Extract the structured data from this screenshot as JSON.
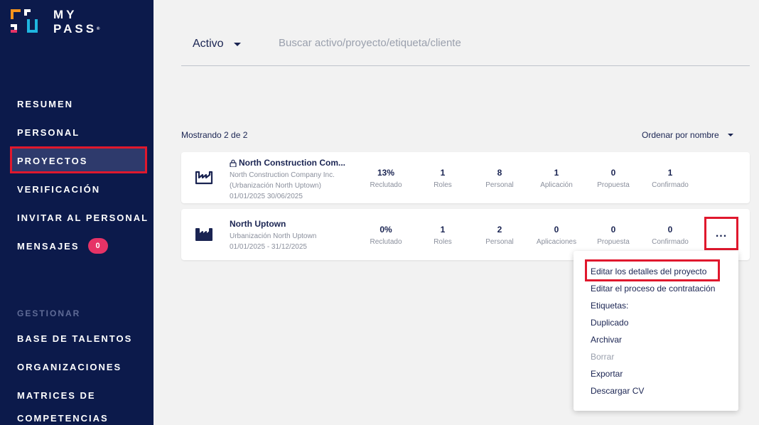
{
  "brand": {
    "line1": "MY",
    "line2": "PASS",
    "mark": "®"
  },
  "nav": {
    "items": [
      {
        "label": "RESUMEN"
      },
      {
        "label": "PERSONAL"
      },
      {
        "label": "PROYECTOS",
        "active": true
      },
      {
        "label": "VERIFICACIÓN"
      },
      {
        "label": "INVITAR AL PERSONAL"
      },
      {
        "label": "MENSAJES",
        "badge": "0"
      }
    ],
    "section_label": "GESTIONAR",
    "manage_items": [
      {
        "label": "BASE DE TALENTOS"
      },
      {
        "label": "ORGANIZACIONES"
      },
      {
        "label": "MATRICES DE"
      },
      {
        "label": "COMPETENCIAS"
      }
    ]
  },
  "header": {
    "status_value": "Activo",
    "search_placeholder": "Buscar activo/proyecto/etiqueta/cliente"
  },
  "list": {
    "showing": "Mostrando 2 de 2",
    "sort_label": "Ordenar por nombre"
  },
  "projects": [
    {
      "title": "North Construction Com...",
      "locked": true,
      "sub1": "North Construction Company Inc.",
      "sub2": "(Urbanización North Uptown)",
      "sub3": "01/01/2025 30/06/2025",
      "stats": [
        {
          "value": "13%",
          "label": "Reclutado"
        },
        {
          "value": "1",
          "label": "Roles"
        },
        {
          "value": "8",
          "label": "Personal"
        },
        {
          "value": "1",
          "label": "Aplicación"
        },
        {
          "value": "0",
          "label": "Propuesta"
        },
        {
          "value": "1",
          "label": "Confirmado"
        }
      ]
    },
    {
      "title": "North Uptown",
      "locked": false,
      "sub1": "Urbanización North Uptown",
      "sub2": "01/01/2025 - 31/12/2025",
      "stats": [
        {
          "value": "0%",
          "label": "Reclutado"
        },
        {
          "value": "1",
          "label": "Roles"
        },
        {
          "value": "2",
          "label": "Personal"
        },
        {
          "value": "0",
          "label": "Aplicaciones"
        },
        {
          "value": "0",
          "label": "Propuesta"
        },
        {
          "value": "0",
          "label": "Confirmado"
        }
      ],
      "more_label": "..."
    }
  ],
  "menu": {
    "items": [
      {
        "label": "Editar los detalles del proyecto"
      },
      {
        "label": "Editar el proceso de contratación"
      },
      {
        "label": "Etiquetas:"
      },
      {
        "label": "Duplicado"
      },
      {
        "label": "Archivar"
      },
      {
        "label": "Borrar",
        "disabled": true
      },
      {
        "label": "Exportar"
      },
      {
        "label": "Descargar CV"
      }
    ]
  },
  "colors": {
    "sidebar": "#0c1a4b",
    "accent_red": "#e0182d",
    "badge": "#e63366",
    "text_primary": "#1a2452"
  },
  "icons": {
    "project": "factory-icon",
    "lock": "lock-icon",
    "dropdown": "caret-down-icon"
  }
}
